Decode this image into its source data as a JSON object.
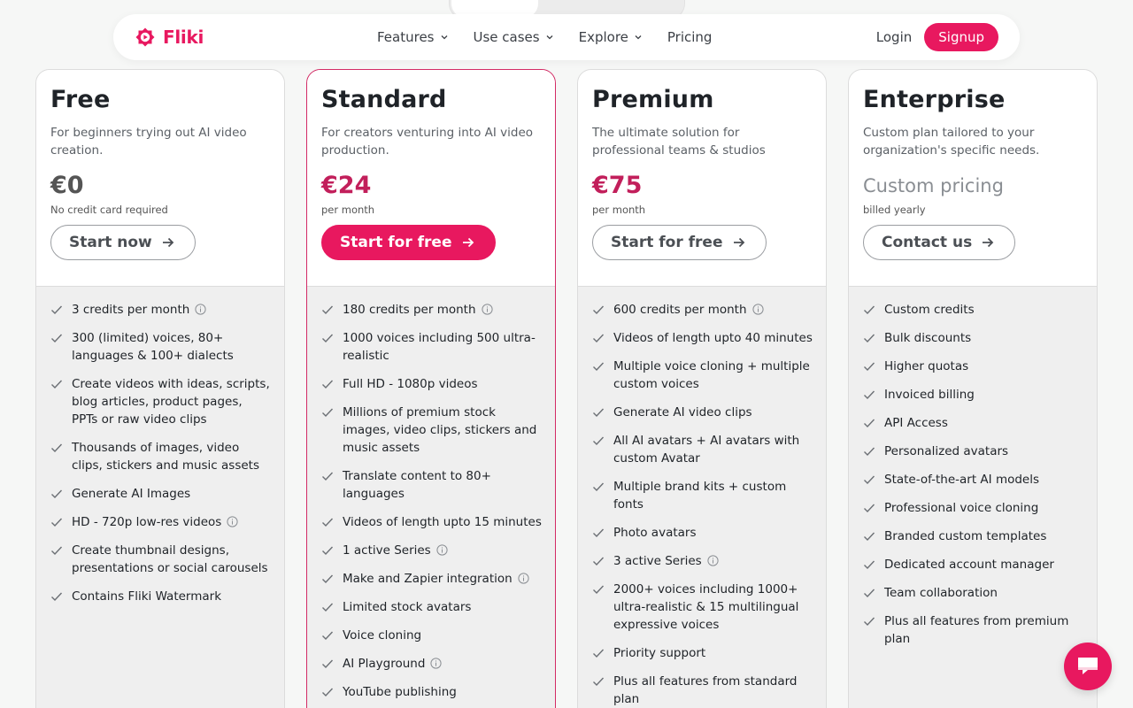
{
  "nav": {
    "brand": "Fliki",
    "menu": [
      {
        "label": "Features",
        "dropdown": true
      },
      {
        "label": "Use cases",
        "dropdown": true
      },
      {
        "label": "Explore",
        "dropdown": true
      },
      {
        "label": "Pricing",
        "dropdown": false
      }
    ],
    "login": "Login",
    "signup": "Signup"
  },
  "colors": {
    "brand": "#e8185f",
    "price_accent": "#c21f5b"
  },
  "plans": [
    {
      "name": "Free",
      "description": "For beginners trying out AI video creation.",
      "price": "€0",
      "price_note": "No credit card required",
      "cta": "Start now",
      "features": [
        {
          "text": "3 credits per month",
          "info": true
        },
        {
          "text": "300 (limited) voices, 80+ languages & 100+ dialects"
        },
        {
          "text": "Create videos with ideas, scripts, blog articles, product pages, PPTs or raw video clips"
        },
        {
          "text": "Thousands of images, video clips, stickers and music assets"
        },
        {
          "text": "Generate AI Images"
        },
        {
          "text": "HD - 720p low-res videos",
          "info": true
        },
        {
          "text": "Create thumbnail designs, presentations or social carousels"
        },
        {
          "text": "Contains Fliki Watermark"
        }
      ]
    },
    {
      "name": "Standard",
      "description": "For creators venturing into AI video production.",
      "price": "€24",
      "price_note": "per month",
      "cta": "Start for free",
      "features": [
        {
          "text": "180 credits per month",
          "info": true
        },
        {
          "text": "1000 voices including 500 ultra-realistic"
        },
        {
          "text": "Full HD - 1080p videos"
        },
        {
          "text": "Millions of premium stock images, video clips, stickers and music assets"
        },
        {
          "text": "Translate content to 80+ languages"
        },
        {
          "text": "Videos of length upto 15 minutes"
        },
        {
          "text": "1 active Series",
          "info": true
        },
        {
          "text": "Make and Zapier integration",
          "info": true
        },
        {
          "text": "Limited stock avatars"
        },
        {
          "text": "Voice cloning"
        },
        {
          "text": "AI Playground",
          "info": true
        },
        {
          "text": "YouTube publishing"
        }
      ]
    },
    {
      "name": "Premium",
      "description": "The ultimate solution for professional teams & studios",
      "price": "€75",
      "price_note": "per month",
      "cta": "Start for free",
      "features": [
        {
          "text": "600 credits per month",
          "info": true
        },
        {
          "text": "Videos of length upto 40 minutes"
        },
        {
          "text": "Multiple voice cloning + multiple custom voices"
        },
        {
          "text": "Generate AI video clips"
        },
        {
          "text": "All AI avatars + AI avatars with custom Avatar"
        },
        {
          "text": "Multiple brand kits + custom fonts"
        },
        {
          "text": "Photo avatars"
        },
        {
          "text": "3 active Series",
          "info": true
        },
        {
          "text": "2000+ voices including 1000+ ultra-realistic & 15 multilingual expressive voices"
        },
        {
          "text": "Priority support"
        },
        {
          "text": "Plus all features from standard plan"
        }
      ]
    },
    {
      "name": "Enterprise",
      "description": "Custom plan tailored to your organization's specific needs.",
      "price": "Custom pricing",
      "price_note": "billed yearly",
      "cta": "Contact us",
      "features": [
        {
          "text": "Custom credits"
        },
        {
          "text": "Bulk discounts"
        },
        {
          "text": "Higher quotas"
        },
        {
          "text": "Invoiced billing"
        },
        {
          "text": "API Access"
        },
        {
          "text": "Personalized avatars"
        },
        {
          "text": "State-of-the-art AI models"
        },
        {
          "text": "Professional voice cloning"
        },
        {
          "text": "Branded custom templates"
        },
        {
          "text": "Dedicated account manager"
        },
        {
          "text": "Team collaboration"
        },
        {
          "text": "Plus all features from premium plan"
        }
      ]
    }
  ]
}
